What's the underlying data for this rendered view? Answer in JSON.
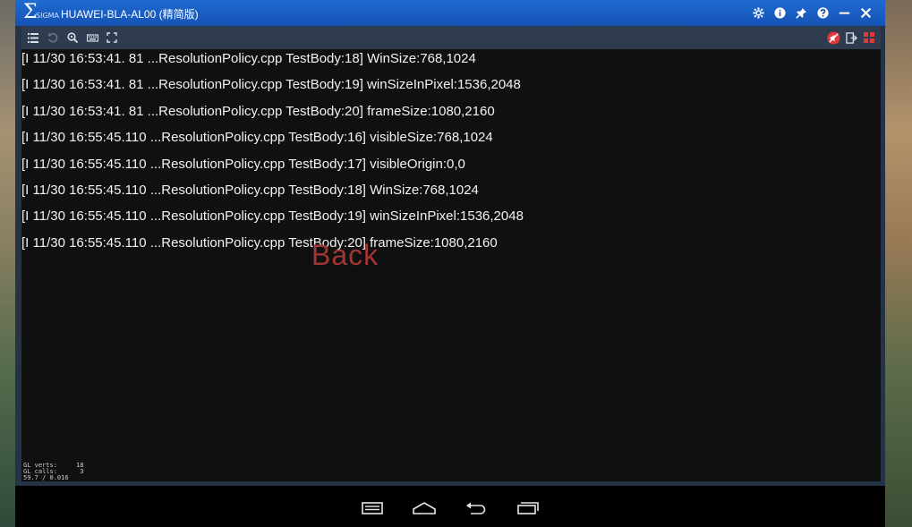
{
  "window": {
    "logo_text": "SIGMA",
    "title": "HUAWEI-BLA-AL00 (精简版)",
    "title_buttons": [
      {
        "icon": "gear-icon"
      },
      {
        "icon": "info-icon"
      },
      {
        "icon": "pin-icon"
      },
      {
        "icon": "help-icon"
      },
      {
        "icon": "minimize-icon"
      },
      {
        "icon": "close-icon"
      }
    ]
  },
  "toolbar": {
    "left_tools": [
      "list-icon",
      "rotate-icon",
      "zoom-icon",
      "keyboard-icon",
      "fullscreen-icon"
    ],
    "right_tools": [
      "mute-icon",
      "exit-icon",
      "grid-icon"
    ]
  },
  "log": {
    "lines": [
      "[I 11/30 16:53:41. 81 ...ResolutionPolicy.cpp TestBody:18] WinSize:768,1024",
      "[I 11/30 16:53:41. 81 ...ResolutionPolicy.cpp TestBody:19] winSizeInPixel:1536,2048",
      "[I 11/30 16:53:41. 81 ...ResolutionPolicy.cpp TestBody:20] frameSize:1080,2160",
      "[I 11/30 16:55:45.110 ...ResolutionPolicy.cpp TestBody:16] visibleSize:768,1024",
      "[I 11/30 16:55:45.110 ...ResolutionPolicy.cpp TestBody:17] visibleOrigin:0,0",
      "[I 11/30 16:55:45.110 ...ResolutionPolicy.cpp TestBody:18] WinSize:768,1024",
      "[I 11/30 16:55:45.110 ...ResolutionPolicy.cpp TestBody:19] winSizeInPixel:1536,2048",
      "[I 11/30 16:55:45.110 ...ResolutionPolicy.cpp TestBody:20] frameSize:1080,2160"
    ],
    "back_label": "Back",
    "stats": {
      "line1": "GL verts:     18",
      "line2": "GL calls:      3",
      "line3": "59.7 / 0.016"
    }
  },
  "navbar": {
    "buttons": [
      "menu-icon",
      "home-icon",
      "back-icon",
      "recent-apps-icon"
    ]
  },
  "colors": {
    "titlebar": "#1a5fc4",
    "screen_bg": "#101010",
    "log_text": "#f2f2f2",
    "back_text": "#a23434"
  }
}
